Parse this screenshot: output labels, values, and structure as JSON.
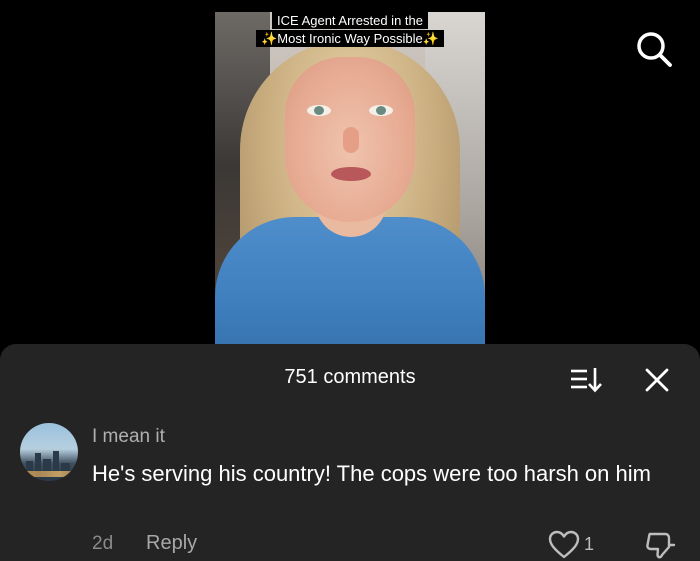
{
  "video": {
    "caption_line1": "ICE Agent Arrested in the",
    "caption_line2": "✨Most Ironic Way Possible✨"
  },
  "top_bar": {
    "search_icon": "search-icon"
  },
  "comments_panel": {
    "title": "751 comments",
    "sort_icon": "sort-icon",
    "close_icon": "close-icon"
  },
  "comments": [
    {
      "username": "I mean it",
      "text": "He's serving his country! The cops were too harsh on him",
      "time": "2d",
      "reply_label": "Reply",
      "like_count": "1",
      "like_icon": "heart-icon",
      "dislike_icon": "dislike-icon"
    }
  ],
  "colors": {
    "background": "#000000",
    "sheet": "#242424",
    "username": "#b0b0b0",
    "meta": "#8a8a8a"
  }
}
